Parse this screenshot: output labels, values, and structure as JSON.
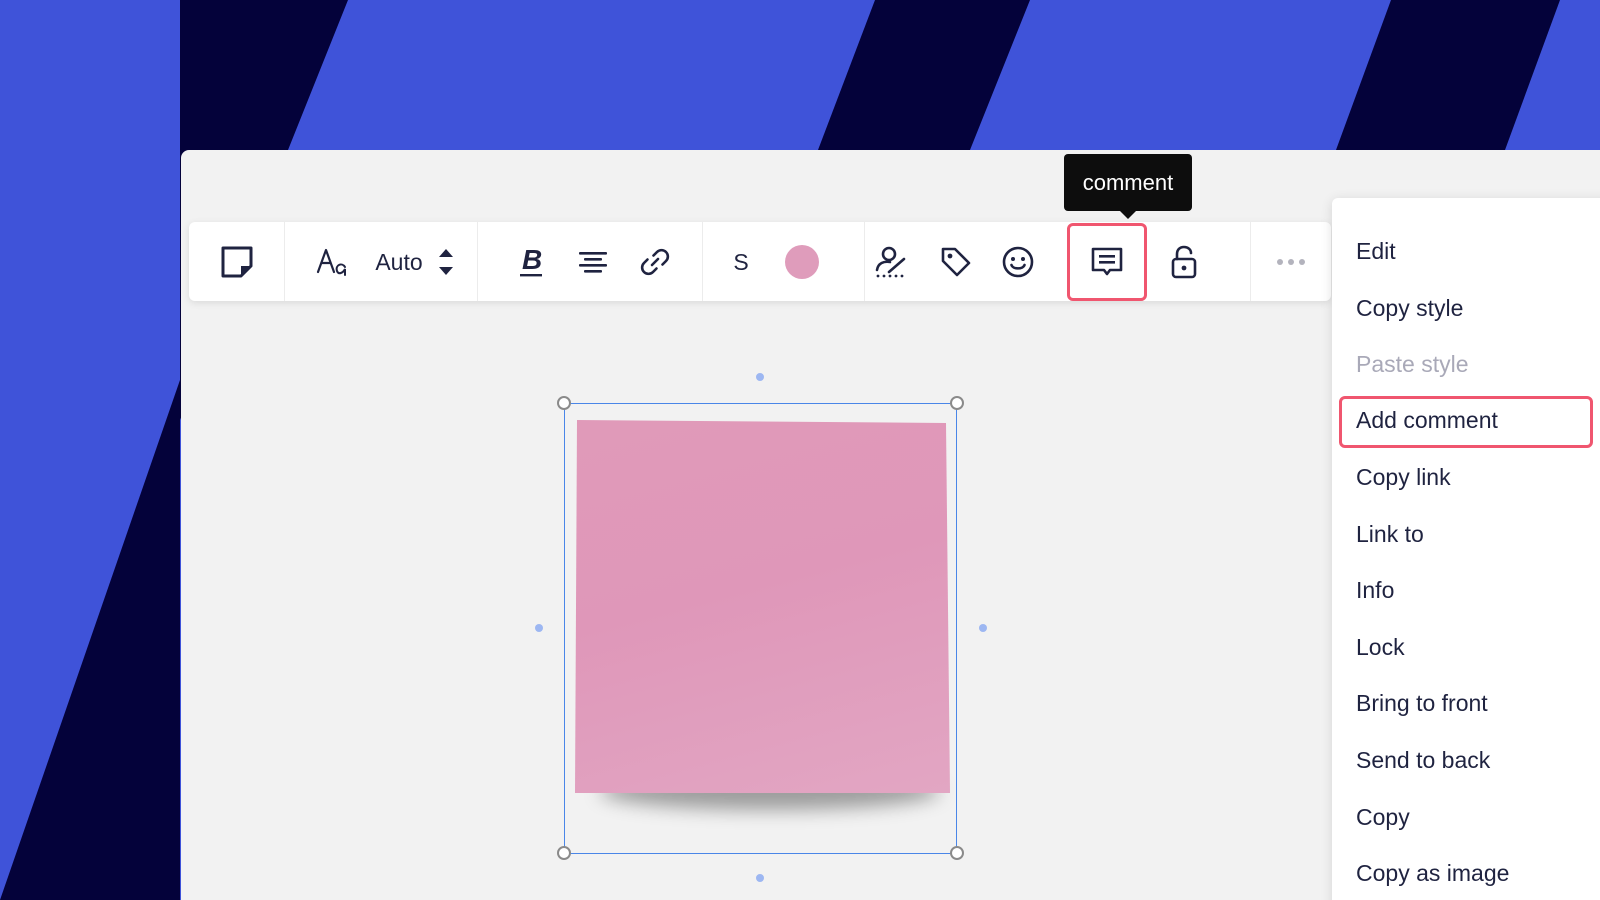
{
  "toolbar": {
    "font_size_value": "Auto",
    "shape_size_label": "S",
    "note_color": "#df9cbb"
  },
  "tooltip": {
    "text": "comment"
  },
  "context_menu": {
    "items": [
      {
        "label": "Edit",
        "enabled": true
      },
      {
        "label": "Copy style",
        "enabled": true
      },
      {
        "label": "Paste style",
        "enabled": false
      },
      {
        "label": "Add comment",
        "enabled": true,
        "highlighted": true
      },
      {
        "label": "Copy link",
        "enabled": true
      },
      {
        "label": "Link to",
        "enabled": true
      },
      {
        "label": "Info",
        "enabled": true
      },
      {
        "label": "Lock",
        "enabled": true
      },
      {
        "label": "Bring to front",
        "enabled": true
      },
      {
        "label": "Send to back",
        "enabled": true
      },
      {
        "label": "Copy",
        "enabled": true
      },
      {
        "label": "Copy as image",
        "enabled": true
      }
    ]
  },
  "colors": {
    "background_blue": "#3f53d9",
    "background_navy": "#04023a",
    "board": "#f2f2f2",
    "highlight_red": "#f0566f",
    "selection_blue": "#4a86e8",
    "text_dark": "#1f2340"
  }
}
